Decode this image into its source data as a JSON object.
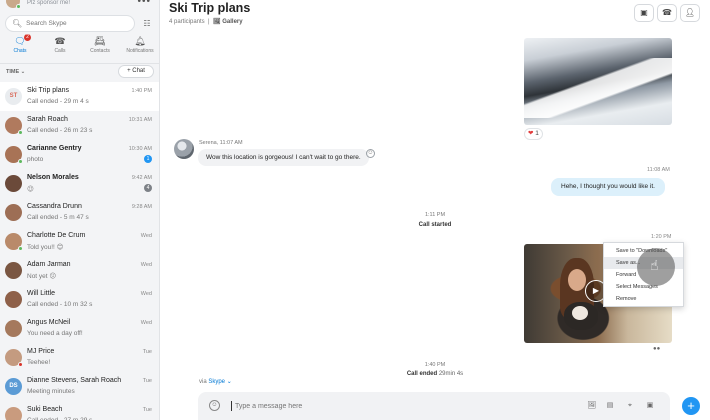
{
  "sidebar": {
    "status": "Plz sponsor me!",
    "more_label": "•••",
    "search": {
      "placeholder": "Search Skype",
      "icon": "search-icon"
    },
    "dialpad_icon": "dialpad-icon",
    "nav": [
      {
        "label": "Chats",
        "icon": "chat-icon",
        "badge": "2",
        "active": true
      },
      {
        "label": "Calls",
        "icon": "phone-icon"
      },
      {
        "label": "Contacts",
        "icon": "contacts-icon"
      },
      {
        "label": "Notifications",
        "icon": "bell-icon"
      }
    ],
    "sort_label": "TIME",
    "new_chat_label": "+ Chat",
    "chats": [
      {
        "name": "Ski Trip plans",
        "initials": "ST",
        "preview": "Call ended - 29 m 4 s",
        "time": "1:40 PM",
        "selected": true,
        "avatar_color": "#e9ecef",
        "initials_color": "#d96b5b"
      },
      {
        "name": "Sarah Roach",
        "preview": "Call ended - 26 m 23 s",
        "time": "10:31 AM",
        "avatar_color": "#b07a5e",
        "status_color": "#5cb85c"
      },
      {
        "name": "Carianne Gentry",
        "preview": "photo",
        "time": "10:30 AM",
        "bold": true,
        "badge": "1",
        "badge_color": "#2196f3",
        "avatar_color": "#a87356",
        "status_color": "#5cb85c"
      },
      {
        "name": "Nelson Morales",
        "preview": "😉",
        "time": "9:42 AM",
        "bold": true,
        "badge": "4",
        "badge_color": "#7d8187",
        "avatar_color": "#6b4a3a"
      },
      {
        "name": "Cassandra Drunn",
        "preview": "Call ended - 5 m 47 s",
        "time": "9:28 AM",
        "avatar_color": "#9d6e55"
      },
      {
        "name": "Charlotte De Crum",
        "preview": "Told you!! 😊",
        "time": "Wed",
        "avatar_color": "#b98a6a",
        "status_color": "#5cb85c"
      },
      {
        "name": "Adam Jarman",
        "preview": "Not yet 😕",
        "time": "Wed",
        "avatar_color": "#7a5642"
      },
      {
        "name": "Will Little",
        "preview": "Call ended - 10 m 32 s",
        "time": "Wed",
        "avatar_color": "#8e6049"
      },
      {
        "name": "Angus McNeil",
        "preview": "You need a day off!",
        "time": "Wed",
        "avatar_color": "#a5795d"
      },
      {
        "name": "MJ Price",
        "preview": "Teehee!",
        "time": "Tue",
        "avatar_color": "#c49b80",
        "status_color": "#d9342b"
      },
      {
        "name": "Dianne Stevens, Sarah Roach",
        "initials": "DS",
        "preview": "Meeting minutes",
        "time": "Tue",
        "avatar_color": "#5b9bd5",
        "initials_color": "#ffffff"
      },
      {
        "name": "Suki Beach",
        "preview": "Call ended - 27 m 29 s",
        "time": "Tue",
        "avatar_color": "#c99b7e"
      }
    ]
  },
  "header": {
    "title": "Ski Trip plans",
    "participants": "4 participants",
    "separator": "|",
    "gallery_label": "Gallery",
    "buttons": [
      "video-call-icon",
      "audio-call-icon",
      "add-people-icon"
    ]
  },
  "messages": {
    "reaction_count": "1",
    "incoming_meta": "Serena, 11:07 AM",
    "incoming_text": "Wow this location is gorgeous! I can't wait to go there.",
    "outgoing_time": "11:08 AM",
    "outgoing_text": "Hehe, I thought you would like it.",
    "call_started_time": "1:11 PM",
    "call_started_label": "Call started",
    "video_time": "1:20 PM",
    "call_ended_time": "1:40 PM",
    "call_ended_label": "Call ended",
    "call_ended_duration": "29min 4s",
    "via_label": "via",
    "via_app": "Skype"
  },
  "context_menu": {
    "items": [
      "Save to \"Downloads\"",
      "Save as...",
      "Forward",
      "Select Messages",
      "Remove"
    ],
    "hovered_index": 1
  },
  "composer": {
    "placeholder": "Type a message here",
    "tools": [
      "image-icon",
      "money-icon",
      "location-icon",
      "video-message-icon"
    ]
  },
  "colors": {
    "accent": "#0078d4",
    "outgoing_bubble": "#dcf0fb",
    "send_button": "#2196f3"
  }
}
